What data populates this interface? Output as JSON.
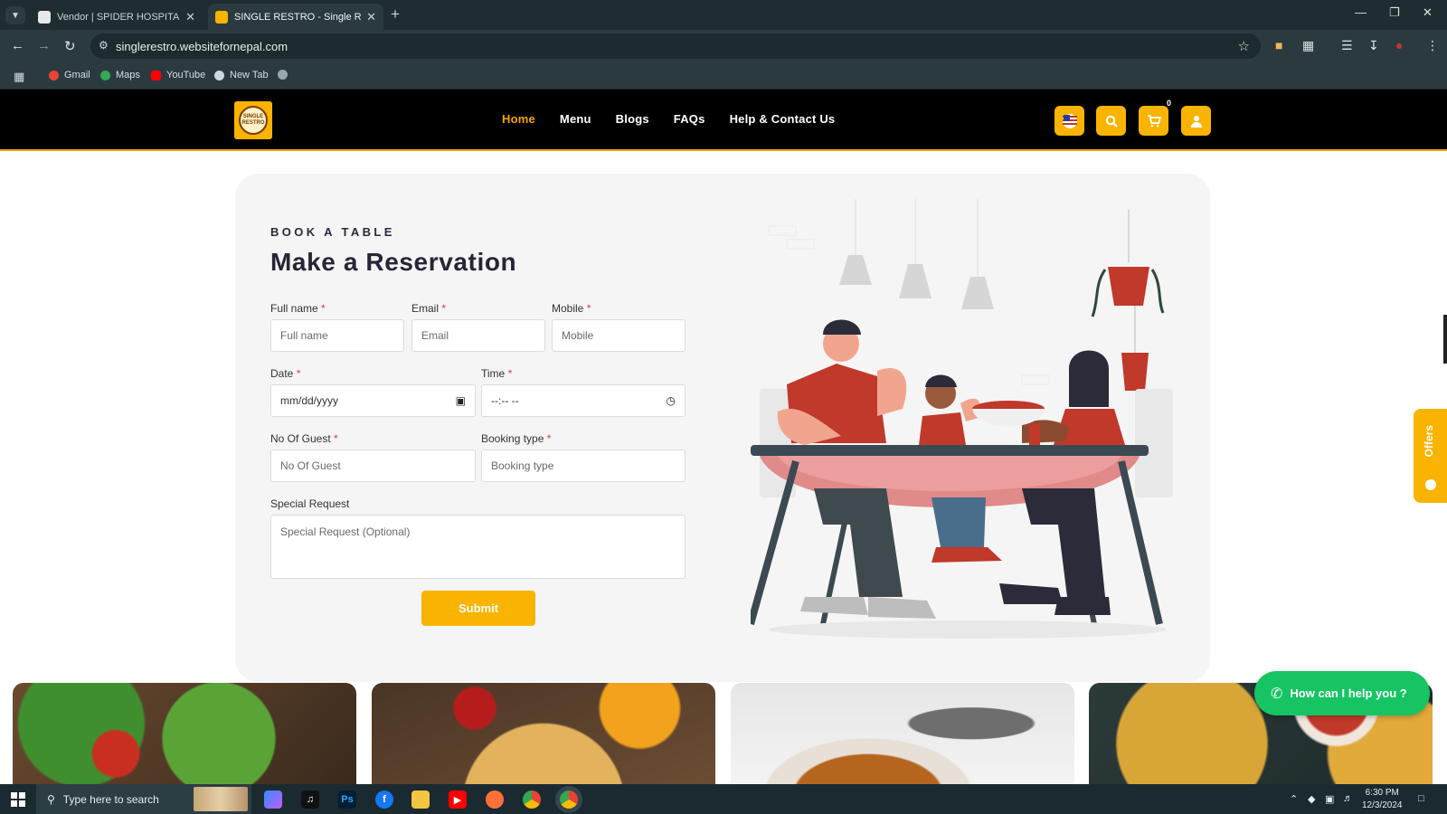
{
  "browser": {
    "tabs": [
      {
        "title": "Vendor | SPIDER HOSPITALITY F",
        "active": false
      },
      {
        "title": "SINGLE RESTRO - Single Restau",
        "active": true
      }
    ],
    "url": "singlerestro.websitefornepal.com",
    "bookmarks": [
      {
        "label": "Gmail",
        "icon": "gmail-icon"
      },
      {
        "label": "Maps",
        "icon": "maps-icon"
      },
      {
        "label": "YouTube",
        "icon": "youtube-icon"
      },
      {
        "label": "New Tab",
        "icon": "newtab-icon"
      }
    ]
  },
  "header": {
    "logo_text": "SINGLE RESTRO",
    "nav": [
      {
        "label": "Home",
        "active": true
      },
      {
        "label": "Menu",
        "active": false
      },
      {
        "label": "Blogs",
        "active": false
      },
      {
        "label": "FAQs",
        "active": false
      },
      {
        "label": "Help & Contact Us",
        "active": false
      }
    ],
    "cart_count": "0",
    "accent": "#f8b400"
  },
  "reservation": {
    "eyebrow": "BOOK A TABLE",
    "title": "Make a Reservation",
    "fields": {
      "full_name": {
        "label": "Full name",
        "placeholder": "Full name",
        "required": "*"
      },
      "email": {
        "label": "Email",
        "placeholder": "Email",
        "required": "*"
      },
      "mobile": {
        "label": "Mobile",
        "placeholder": "Mobile",
        "required": "*"
      },
      "date": {
        "label": "Date",
        "placeholder": "mm/dd/yyyy",
        "required": "*"
      },
      "time": {
        "label": "Time",
        "placeholder": "--:-- --",
        "required": "*"
      },
      "guests": {
        "label": "No Of Guest",
        "placeholder": "No Of Guest",
        "required": "*"
      },
      "booking_type": {
        "label": "Booking type",
        "placeholder": "Booking type",
        "required": "*"
      },
      "special": {
        "label": "Special Request",
        "placeholder": "Special Request (Optional)"
      }
    },
    "submit_label": "Submit"
  },
  "widgets": {
    "offers_label": "Offers",
    "help_label": "How can I help you ?"
  },
  "taskbar": {
    "search_placeholder": "Type here to search",
    "time": "6:30 PM",
    "date": "12/3/2024"
  }
}
